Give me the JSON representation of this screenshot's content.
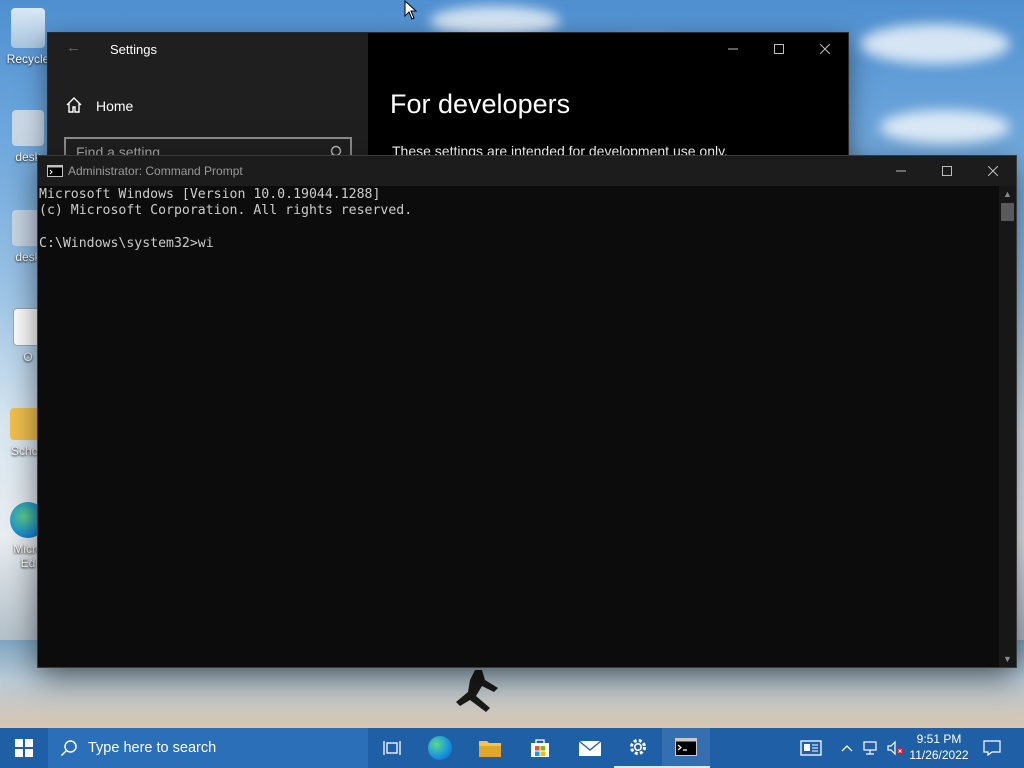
{
  "desktop": {
    "icons": [
      {
        "label": "Recycle",
        "icon": "recycle-bin-icon"
      },
      {
        "label": "desk",
        "icon": "app-icon"
      },
      {
        "label": "desk",
        "icon": "app-icon"
      },
      {
        "label": "O",
        "icon": "image-file-icon"
      },
      {
        "label": "Schoo",
        "icon": "folder-icon"
      },
      {
        "label": "Micro",
        "label2": "Ed",
        "icon": "edge-icon"
      }
    ]
  },
  "settings": {
    "title": "Settings",
    "nav_home": "Home",
    "search_placeholder": "Find a setting",
    "page_heading": "For developers",
    "page_description": "These settings are intended for development use only."
  },
  "cmd": {
    "title": "Administrator: Command Prompt",
    "output": "Microsoft Windows [Version 10.0.19044.1288]\n(c) Microsoft Corporation. All rights reserved.\n\nC:\\Windows\\system32>wi"
  },
  "taskbar": {
    "search_placeholder": "Type here to search",
    "apps": [
      "task-view",
      "edge",
      "file-explorer",
      "microsoft-store",
      "mail",
      "settings",
      "command-prompt"
    ],
    "active_app": "command-prompt",
    "time": "9:51 PM",
    "date": "11/26/2022"
  },
  "colors": {
    "taskbar": "#1f5fa6",
    "console_bg": "#0c0c0c",
    "console_text": "#cccccc"
  }
}
